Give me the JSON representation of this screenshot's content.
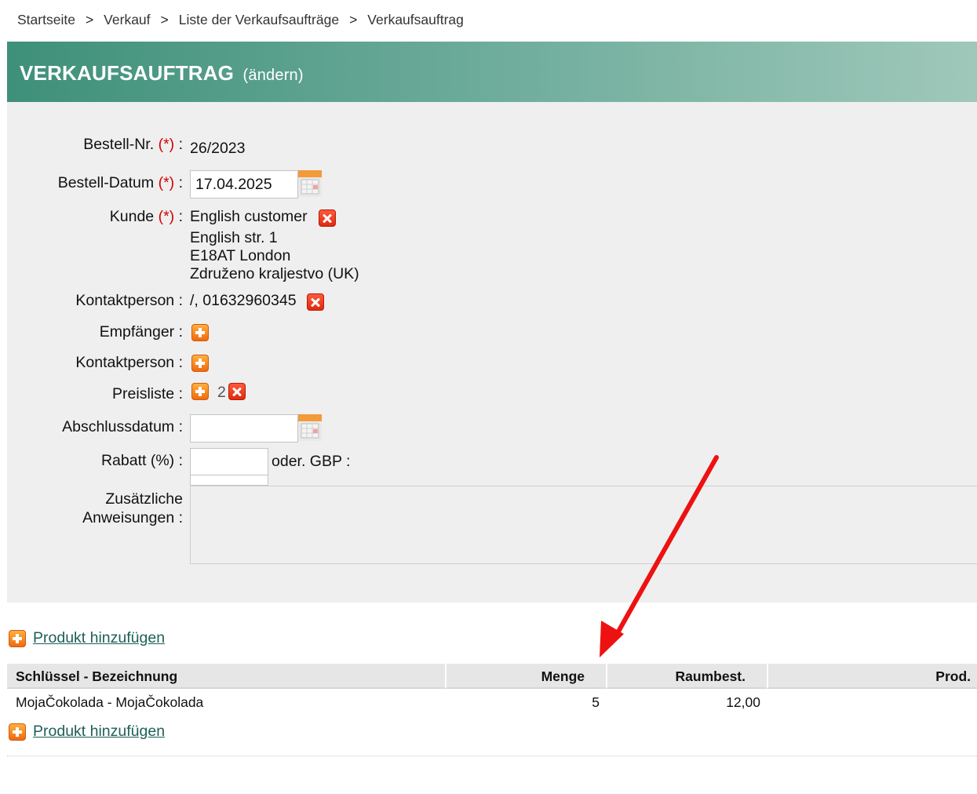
{
  "breadcrumb": {
    "items": [
      "Startseite",
      "Verkauf",
      "Liste der Verkaufsaufträge",
      "Verkaufsauftrag"
    ],
    "separator": ">"
  },
  "header": {
    "title": "VERKAUFSAUFTRAG",
    "mode": "(ändern)",
    "gradient_colors": [
      "#3e9079",
      "#9fc8ba"
    ]
  },
  "form": {
    "required_mark": "(*)",
    "order_number": {
      "label": "Bestell-Nr.",
      "value": "26/2023"
    },
    "order_date": {
      "label": "Bestell-Datum",
      "value": "17.04.2025"
    },
    "customer": {
      "label": "Kunde",
      "name": "English customer",
      "address": [
        "English str. 1",
        "E18AT London",
        "Združeno kraljestvo (UK)"
      ]
    },
    "contact_person": {
      "label": "Kontaktperson :",
      "value": "/, 01632960345"
    },
    "recipient": {
      "label": "Empfänger :"
    },
    "recipient_contact": {
      "label": "Kontaktperson :"
    },
    "price_list": {
      "label": "Preisliste :",
      "value": "2"
    },
    "closing_date": {
      "label": "Abschlussdatum :",
      "value": ""
    },
    "discount": {
      "label": "Rabatt (%) :",
      "value": "",
      "alt_label": "oder. GBP :"
    },
    "instructions": {
      "label_line1": "Zusätzliche",
      "label_line2": "Anweisungen :",
      "value": ""
    }
  },
  "products": {
    "add_label": "Produkt hinzufügen",
    "columns": [
      "Schlüssel - Bezeichnung",
      "Menge",
      "Raumbest.",
      "Prod."
    ],
    "rows": [
      {
        "name": "MojaČokolada - MojaČokolada",
        "quantity": "5",
        "room_stock": "12,00",
        "prod": ""
      }
    ]
  },
  "annotation": {
    "arrow_color": "#ee1111"
  }
}
